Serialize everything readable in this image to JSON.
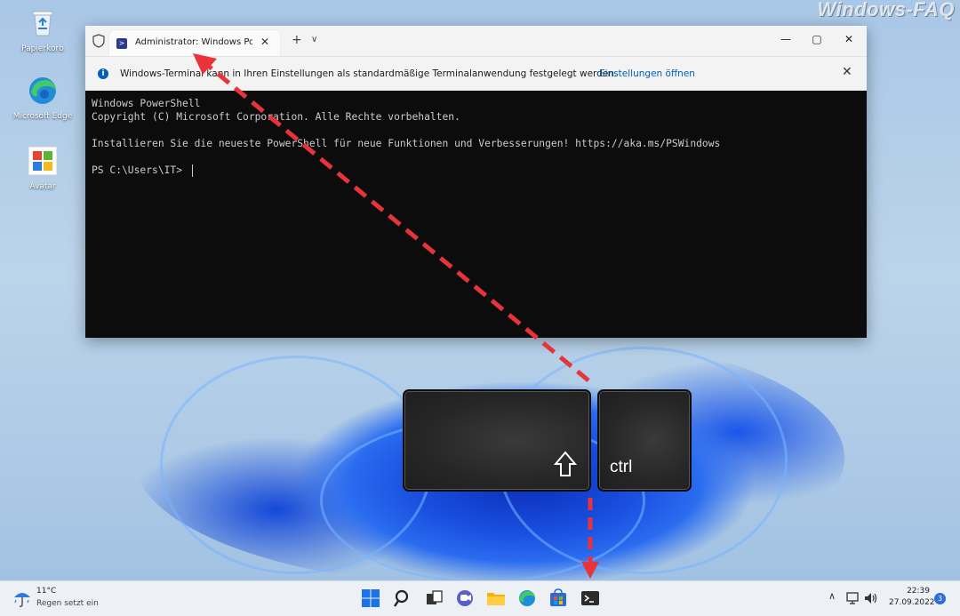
{
  "watermark": "Windows-FAQ",
  "desktop": {
    "icons": [
      {
        "label": "Papierkorb",
        "icon": "recycle-bin-icon"
      },
      {
        "label": "Microsoft Edge",
        "icon": "edge-icon"
      },
      {
        "label": "Avatar",
        "icon": "avatar-icon"
      }
    ]
  },
  "terminal": {
    "tab_title": "Administrator: Windows PowerShell",
    "info_message": "Windows-Terminal kann in Ihren Einstellungen als standardmäßige Terminalanwendung festgelegt werden.",
    "info_link": "Einstellungen öffnen",
    "console_lines": [
      "Windows PowerShell",
      "Copyright (C) Microsoft Corporation. Alle Rechte vorbehalten.",
      "",
      "Installieren Sie die neueste PowerShell für neue Funktionen und Verbesserungen! https://aka.ms/PSWindows",
      "",
      "PS C:\\Users\\IT> "
    ]
  },
  "keys": {
    "shift_symbol": "shift-arrow-icon",
    "ctrl_label": "ctrl"
  },
  "taskbar": {
    "weather_temp": "11°C",
    "weather_condition": "Regen setzt ein",
    "time": "22:39",
    "date": "27.09.2022",
    "notification_count": "3"
  },
  "colors": {
    "accent": "#005fb8",
    "arrow": "#e8333a",
    "console_bg": "#0c0c0c"
  }
}
